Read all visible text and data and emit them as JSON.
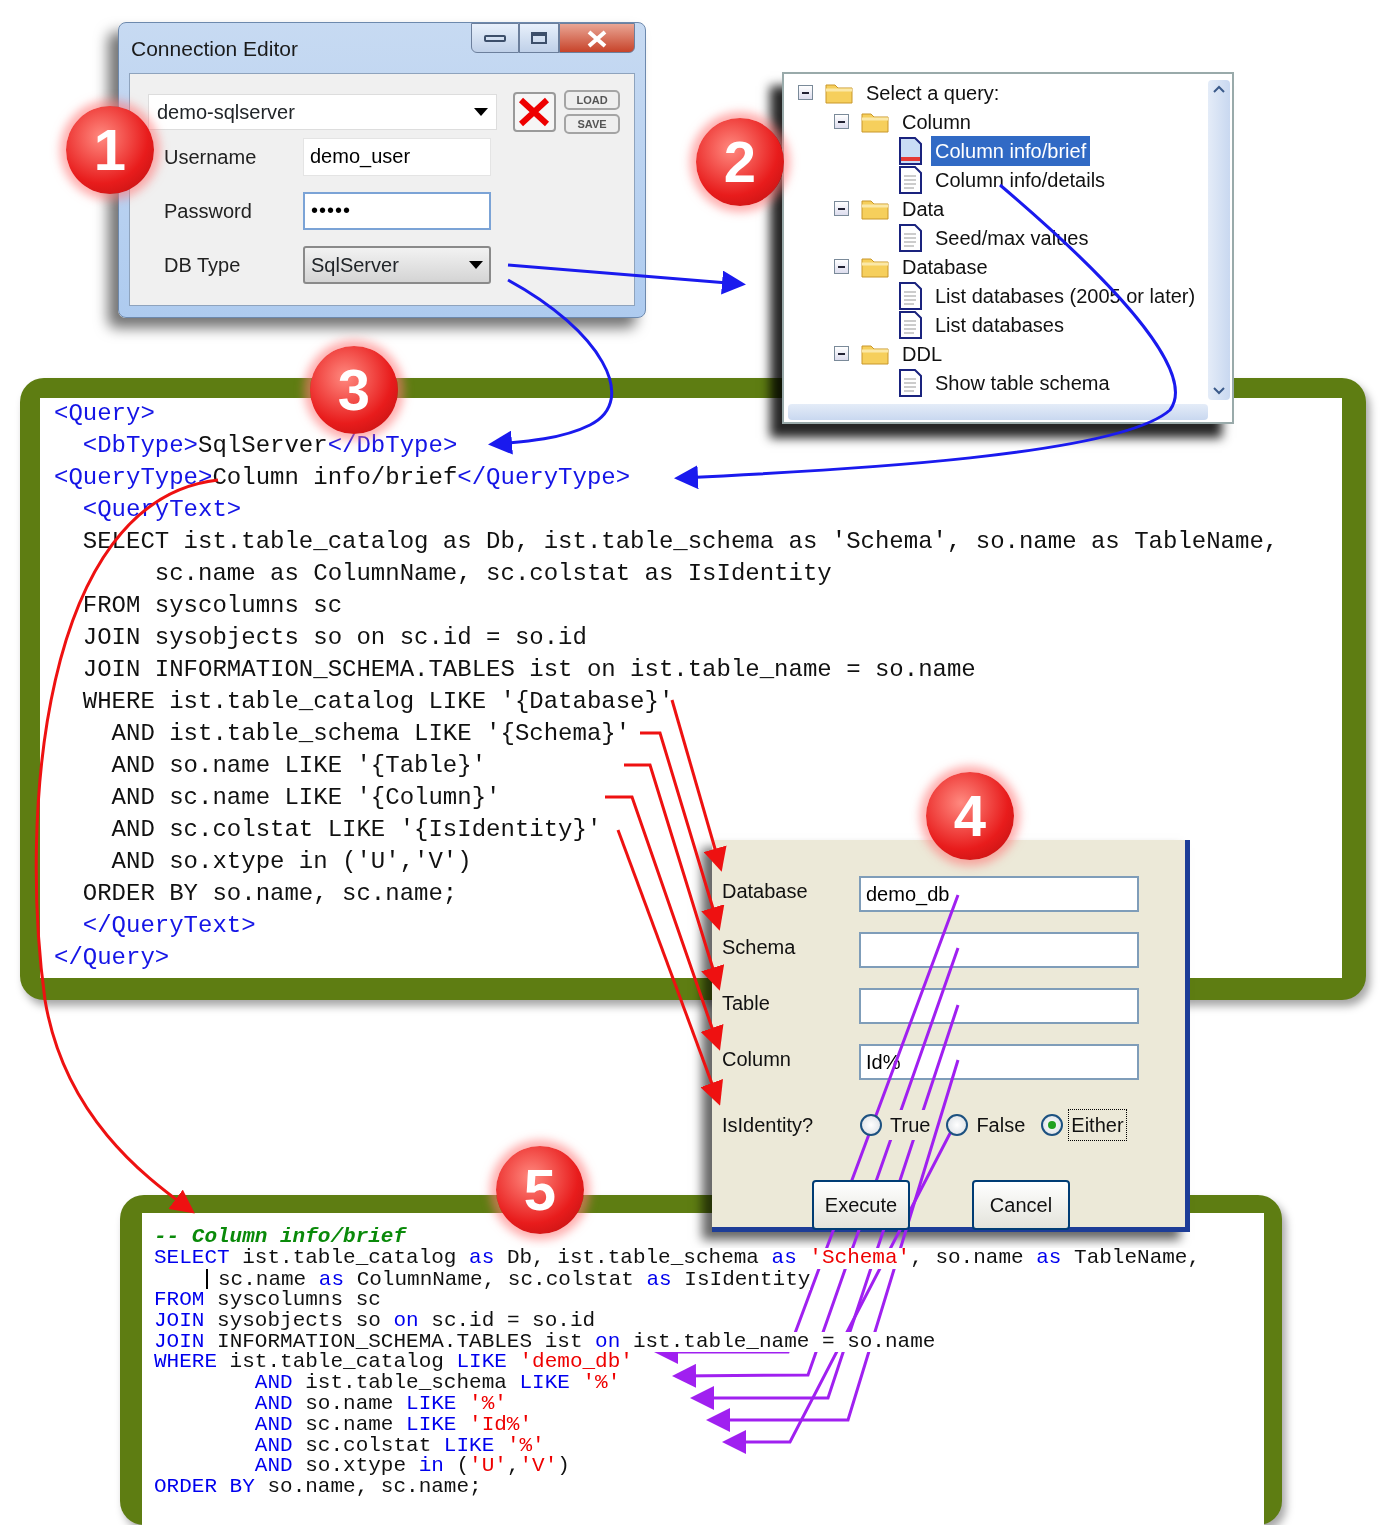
{
  "step_badges": [
    "1",
    "2",
    "3",
    "4",
    "5"
  ],
  "connection_editor": {
    "title": "Connection Editor",
    "connection": "demo-sqlserver",
    "buttons": [
      "LOAD",
      "SAVE"
    ],
    "fields": [
      {
        "label": "Username",
        "value": "demo_user",
        "kind": "text"
      },
      {
        "label": "Password",
        "value": "•••••",
        "kind": "password"
      },
      {
        "label": "DB Type",
        "value": "SqlServer",
        "kind": "dropdown"
      }
    ]
  },
  "query_tree": {
    "items": [
      {
        "label": "Select a query:",
        "kind": "folder",
        "expanded": true,
        "selected": false,
        "children": [
          {
            "label": "Column",
            "kind": "folder",
            "expanded": true,
            "selected": false,
            "children": [
              {
                "label": "Column info/brief",
                "kind": "document",
                "selected": true
              },
              {
                "label": "Column info/details",
                "kind": "document",
                "selected": false
              }
            ]
          },
          {
            "label": "Data",
            "kind": "folder",
            "expanded": true,
            "selected": false,
            "children": [
              {
                "label": "Seed/max values",
                "kind": "document",
                "selected": false
              }
            ]
          },
          {
            "label": "Database",
            "kind": "folder",
            "expanded": true,
            "selected": false,
            "children": [
              {
                "label": "List databases (2005 or later)",
                "kind": "document",
                "selected": false
              },
              {
                "label": "List databases",
                "kind": "document",
                "selected": false
              }
            ]
          },
          {
            "label": "DDL",
            "kind": "folder",
            "expanded": true,
            "selected": false,
            "children": [
              {
                "label": "Show table schema",
                "kind": "document",
                "selected": false
              }
            ]
          }
        ]
      }
    ]
  },
  "query_xml": {
    "lines": [
      [
        {
          "text": "<Query>",
          "kind": "tag"
        }
      ],
      [
        {
          "text": "  <DbType>",
          "kind": "tag"
        },
        {
          "text": "SqlServer",
          "kind": "plain"
        },
        {
          "text": "</DbType>",
          "kind": "tag"
        }
      ],
      [
        {
          "text": "<QueryType>",
          "kind": "tag"
        },
        {
          "text": "Column info/brief",
          "kind": "plain"
        },
        {
          "text": "</QueryType>",
          "kind": "tag"
        }
      ],
      [
        {
          "text": "  <QueryText>",
          "kind": "tag"
        }
      ],
      [
        {
          "text": "  SELECT ist.table_catalog as Db, ist.table_schema as 'Schema', so.name as TableName,",
          "kind": "plain"
        }
      ],
      [
        {
          "text": "       sc.name as ColumnName, sc.colstat as IsIdentity",
          "kind": "plain"
        }
      ],
      [
        {
          "text": "  FROM syscolumns sc",
          "kind": "plain"
        }
      ],
      [
        {
          "text": "  JOIN sysobjects so on sc.id = so.id",
          "kind": "plain"
        }
      ],
      [
        {
          "text": "  JOIN INFORMATION_SCHEMA.TABLES ist on ist.table_name = so.name",
          "kind": "plain"
        }
      ],
      [
        {
          "text": "  WHERE ist.table_catalog LIKE '{Database}'",
          "kind": "plain"
        }
      ],
      [
        {
          "text": "    AND ist.table_schema LIKE '{Schema}'",
          "kind": "plain"
        }
      ],
      [
        {
          "text": "    AND so.name LIKE '{Table}'",
          "kind": "plain"
        }
      ],
      [
        {
          "text": "    AND sc.name LIKE '{Column}'",
          "kind": "plain"
        }
      ],
      [
        {
          "text": "    AND sc.colstat LIKE '{IsIdentity}'",
          "kind": "plain"
        }
      ],
      [
        {
          "text": "    AND so.xtype in ('U','V')",
          "kind": "plain"
        }
      ],
      [
        {
          "text": "  ORDER BY so.name, sc.name;",
          "kind": "plain"
        }
      ],
      [
        {
          "text": "  </QueryText>",
          "kind": "tag"
        }
      ],
      [
        {
          "text": "</Query>",
          "kind": "tag"
        }
      ]
    ]
  },
  "parameters_dialog": {
    "fields": [
      {
        "label": "Database",
        "value": "demo_db"
      },
      {
        "label": "Schema"
      },
      {
        "label": "Table"
      },
      {
        "label": "Column",
        "value": "Id%"
      }
    ],
    "isidentity": {
      "label": "IsIdentity?",
      "options": [
        {
          "label": "True",
          "selected": false
        },
        {
          "label": "False",
          "selected": false
        },
        {
          "label": "Either",
          "selected": true
        }
      ]
    },
    "buttons": [
      "Execute",
      "Cancel"
    ]
  },
  "sql_output": {
    "lines": [
      [
        {
          "text": "-- Column info/brief",
          "kind": "comment"
        }
      ],
      [
        {
          "text": "SELECT",
          "kind": "keyword"
        },
        {
          "text": " ist.table_catalog ",
          "kind": "plain"
        },
        {
          "text": "as",
          "kind": "keyword"
        },
        {
          "text": " Db, ist.table_schema ",
          "kind": "plain"
        },
        {
          "text": "as ",
          "kind": "keyword"
        },
        {
          "text": "'Schema'",
          "kind": "string"
        },
        {
          "text": ", so.name ",
          "kind": "plain"
        },
        {
          "text": "as",
          "kind": "keyword"
        },
        {
          "text": " TableName,",
          "kind": "plain"
        }
      ],
      [
        {
          "kind": "cursor"
        },
        {
          "text": "sc.name ",
          "kind": "plain"
        },
        {
          "text": "as",
          "kind": "keyword"
        },
        {
          "text": " ColumnName, sc.colstat ",
          "kind": "plain"
        },
        {
          "text": "as",
          "kind": "keyword"
        },
        {
          "text": " IsIdentity",
          "kind": "plain"
        }
      ],
      [
        {
          "text": "FROM",
          "kind": "keyword"
        },
        {
          "text": " syscolumns sc",
          "kind": "plain"
        }
      ],
      [
        {
          "text": "JOIN",
          "kind": "keyword"
        },
        {
          "text": " sysobjects so ",
          "kind": "plain"
        },
        {
          "text": "on",
          "kind": "keyword"
        },
        {
          "text": " sc.id = so.id",
          "kind": "plain"
        }
      ],
      [
        {
          "text": "JOIN",
          "kind": "keyword"
        },
        {
          "text": " INFORMATION_SCHEMA.TABLES ist ",
          "kind": "plain"
        },
        {
          "text": "on",
          "kind": "keyword"
        },
        {
          "text": " ist.table_name = so.name",
          "kind": "plain"
        }
      ],
      [
        {
          "text": "WHERE",
          "kind": "keyword"
        },
        {
          "text": " ist.table_catalog ",
          "kind": "plain"
        },
        {
          "text": "LIKE ",
          "kind": "keyword"
        },
        {
          "text": "'demo_db'",
          "kind": "string"
        }
      ],
      [
        {
          "text": "        AND",
          "kind": "keyword"
        },
        {
          "text": " ist.table_schema ",
          "kind": "plain"
        },
        {
          "text": "LIKE ",
          "kind": "keyword"
        },
        {
          "text": "'%'",
          "kind": "string"
        }
      ],
      [
        {
          "text": "        AND",
          "kind": "keyword"
        },
        {
          "text": " so.name ",
          "kind": "plain"
        },
        {
          "text": "LIKE ",
          "kind": "keyword"
        },
        {
          "text": "'%'",
          "kind": "string"
        }
      ],
      [
        {
          "text": "        AND",
          "kind": "keyword"
        },
        {
          "text": " sc.name ",
          "kind": "plain"
        },
        {
          "text": "LIKE ",
          "kind": "keyword"
        },
        {
          "text": "'Id%'",
          "kind": "string"
        }
      ],
      [
        {
          "text": "        AND",
          "kind": "keyword"
        },
        {
          "text": " sc.colstat ",
          "kind": "plain"
        },
        {
          "text": "LIKE ",
          "kind": "keyword"
        },
        {
          "text": "'%'",
          "kind": "string"
        }
      ],
      [
        {
          "text": "        AND",
          "kind": "keyword"
        },
        {
          "text": " so.xtype ",
          "kind": "plain"
        },
        {
          "text": "in",
          "kind": "keyword"
        },
        {
          "text": " (",
          "kind": "plain"
        },
        {
          "text": "'U'",
          "kind": "string"
        },
        {
          "text": ",",
          "kind": "plain"
        },
        {
          "text": "'V'",
          "kind": "string"
        },
        {
          "text": ")",
          "kind": "plain"
        }
      ],
      [
        {
          "text": "ORDER BY",
          "kind": "keyword"
        },
        {
          "text": " so.name, sc.name;",
          "kind": "plain"
        }
      ]
    ]
  }
}
